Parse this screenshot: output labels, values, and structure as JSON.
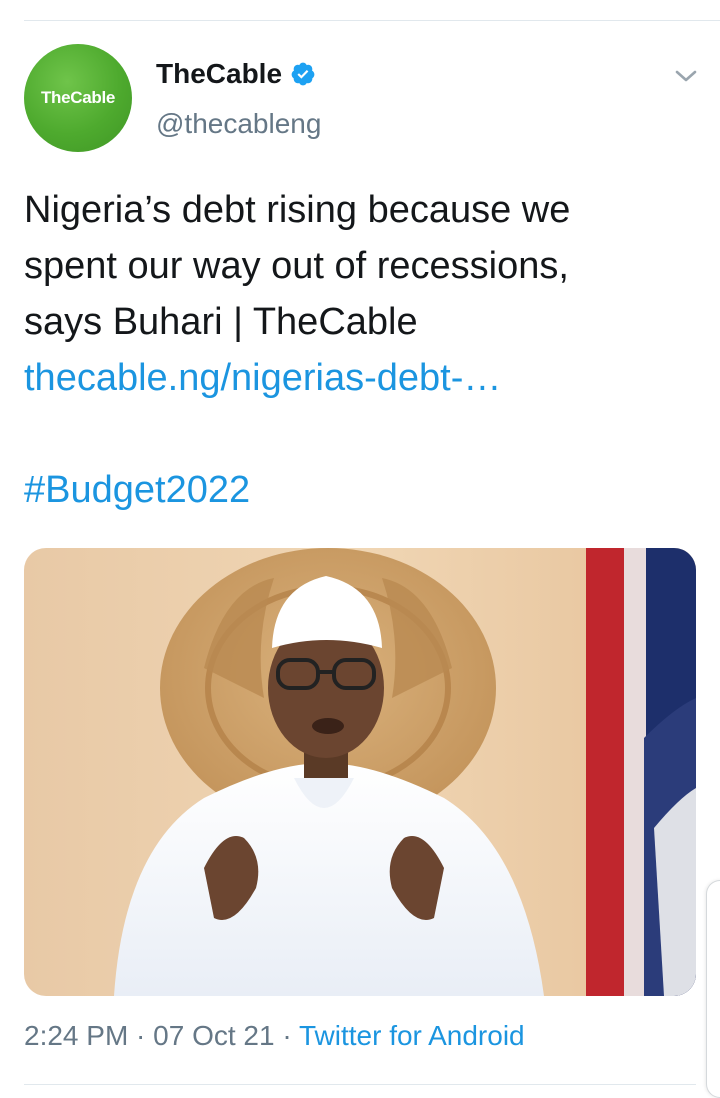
{
  "account": {
    "avatar_text": "TheCable",
    "display_name": "TheCable",
    "handle": "@thecableng",
    "verified": true
  },
  "tweet": {
    "lines": [
      "Nigeria’s debt rising because we",
      "spent our way out of recessions,",
      "says Buhari | TheCable"
    ],
    "link": "thecable.ng/nigerias-debt-…",
    "hashtag": "#Budget2022"
  },
  "meta": {
    "time": "2:24 PM",
    "separator1": " · ",
    "date": "07 Oct 21",
    "separator2": " · ",
    "source": "Twitter for Android"
  },
  "icons": {
    "verified": "verified-badge-icon",
    "menu": "chevron-down-icon"
  },
  "colors": {
    "link": "#1b95e0",
    "secondary_text": "#657786",
    "brand_green": "#4eaa2e",
    "divider": "#e1e8ed"
  }
}
